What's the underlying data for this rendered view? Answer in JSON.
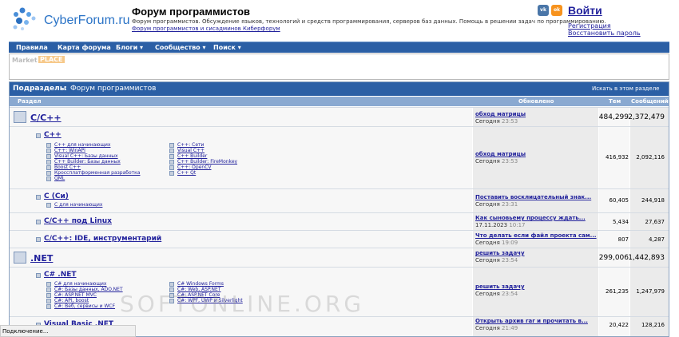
{
  "header": {
    "logo_text": "CyberForum.ru",
    "title": "Форум программистов",
    "description": "Форум программистов. Обсуждение языков, технологий и средств программирования, серверов баз данных. Помощь в решении задач по программированию.",
    "subtitle_link": "Форум программистов и сисадминов Киберфорум",
    "social": [
      {
        "label": "vk",
        "icon": "vk-icon",
        "color": "#4a76a8"
      },
      {
        "label": "ok",
        "icon": "odnoklassniki-icon",
        "color": "#f7931e"
      }
    ],
    "login": "Войти",
    "register": "Регистрация",
    "restore": "Восстановить пароль"
  },
  "nav": [
    "Правила",
    "Карта форума",
    "Блоги ▾",
    "Сообщество ▾",
    "Поиск ▾"
  ],
  "marketplace": {
    "part1": "Market",
    "part2": "PLACE"
  },
  "table": {
    "cat_title": "Подразделы",
    "cat_sep": ": ",
    "cat_name": "Форум программистов",
    "search_here": "Искать в этом разделе",
    "col_section": "Раздел",
    "col_updated": "Обновлено",
    "col_threads": "Тем",
    "col_posts": "Сообщений",
    "rows": [
      {
        "title": "C/C++",
        "last_post": "обход матрицы",
        "last_time": "Сегодня",
        "last_hm": "23:53",
        "threads": "484,299",
        "posts": "2,372,479"
      },
      {
        "title": "C++",
        "last_post": "обход матрицы",
        "last_time": "Сегодня",
        "last_hm": "23:53",
        "threads": "416,932",
        "posts": "2,092,116",
        "subs_left": [
          "C++ для начинающих",
          "C++: WinAPI",
          "Visual C++: Базы данных",
          "C++ Builder: Базы данных",
          "Boost C++",
          "Кроссплатформенная разработка",
          "QML"
        ],
        "subs_right": [
          "C++: Сети",
          "Visual C++",
          "C++ Builder",
          "C++ Builder: FireMonkey",
          "C++: OpenCV",
          "C++ Qt"
        ]
      },
      {
        "title": "C (Си)",
        "last_post": "Поставить восклицательный знак...",
        "last_time": "Сегодня",
        "last_hm": "23:31",
        "threads": "60,405",
        "posts": "244,918",
        "subs_left": [
          "C для начинающих"
        ]
      },
      {
        "title": "C/C++ под Linux",
        "last_post": "Как сыновьему процессу ждать...",
        "last_time": "17.11.2023",
        "last_hm": "10:17",
        "threads": "5,434",
        "posts": "27,637"
      },
      {
        "title": "C/C++: IDE, инструментарий",
        "last_post": "Что делать если файл проекта сам...",
        "last_time": "Сегодня",
        "last_hm": "19:09",
        "threads": "807",
        "posts": "4,287"
      },
      {
        "title": ".NET",
        "last_post": "решить задачу",
        "last_time": "Сегодня",
        "last_hm": "23:54",
        "threads": "299,006",
        "posts": "1,442,893"
      },
      {
        "title": "C# .NET",
        "last_post": "решить задачу",
        "last_time": "Сегодня",
        "last_hm": "23:54",
        "threads": "261,235",
        "posts": "1,247,979",
        "subs_left": [
          "C# для начинающих",
          "C#: Базы данных, ADO.NET",
          "C#: ASP.NET MVC",
          "C#: API, boost",
          "C#: Веб, сервисы и WCF"
        ],
        "subs_right": [
          "C# Windows Forms",
          "C#: Web, ASP.NET",
          "C#: ASP.NET Core",
          "C#: WPF, UWP и Silverlight"
        ]
      },
      {
        "title": "Visual Basic .NET",
        "last_post": "Открыть архив rar и прочитать в...",
        "last_time": "Сегодня",
        "last_hm": "21:49",
        "threads": "20,422",
        "posts": "128,216"
      }
    ]
  },
  "status_text": "Подключение...",
  "watermark": "SOFTONLINE.ORG"
}
